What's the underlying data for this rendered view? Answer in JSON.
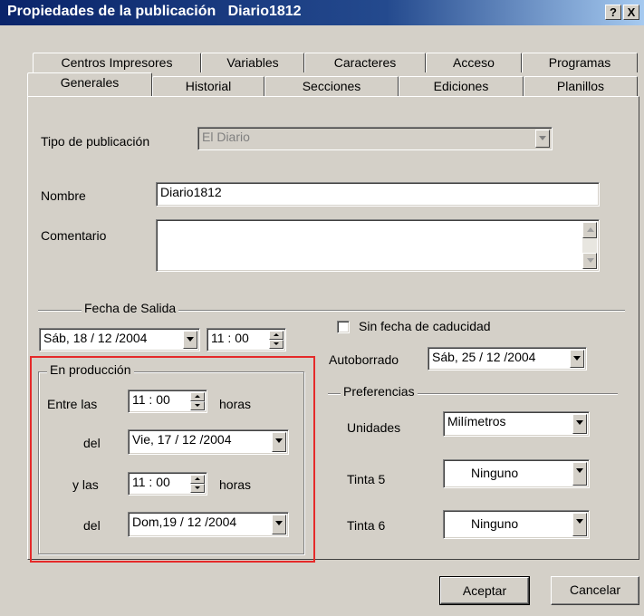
{
  "window": {
    "title": "Propiedades de la publicación   Diario1812",
    "help_button": "?",
    "close_button": "X"
  },
  "tabs": {
    "row_back": [
      "Centros Impresores",
      "Variables",
      "Caracteres",
      "Acceso",
      "Programas"
    ],
    "row_front": [
      "Generales",
      "Historial",
      "Secciones",
      "Ediciones",
      "Planillos"
    ],
    "active": "Generales"
  },
  "general": {
    "tipo_label": "Tipo de publicación",
    "tipo_value": "El Diario",
    "nombre_label": "Nombre",
    "nombre_value": "Diario1812",
    "comentario_label": "Comentario",
    "comentario_value": ""
  },
  "fecha_salida": {
    "group_label": "Fecha de Salida",
    "date_value": "Sáb, 18 / 12 /2004",
    "time_value": "11 : 00"
  },
  "caducidad": {
    "checkbox_label": "Sin fecha de caducidad",
    "checked": false,
    "autoborrado_label": "Autoborrado",
    "autoborrado_value": "Sáb, 25 / 12 /2004"
  },
  "produccion": {
    "group_label": "En producción",
    "entre_label": "Entre las",
    "entre_time": "11 : 00",
    "horas_label_1": "horas",
    "del_label_1": "del",
    "del_date_1": "Vie, 17 / 12 /2004",
    "ylas_label": "y las",
    "ylas_time": "11 : 00",
    "horas_label_2": "horas",
    "del_label_2": "del",
    "del_date_2": "Dom,19 / 12 /2004"
  },
  "preferencias": {
    "group_label": "Preferencias",
    "unidades_label": "Unidades",
    "unidades_value": "Milímetros",
    "tinta5_label": "Tinta 5",
    "tinta5_value": "Ninguno",
    "tinta6_label": "Tinta 6",
    "tinta6_value": "Ninguno"
  },
  "buttons": {
    "ok": "Aceptar",
    "cancel": "Cancelar"
  },
  "colors": {
    "titlebar": "#0a246a",
    "face": "#d4d0c8",
    "highlight_box": "#e52a2a"
  }
}
